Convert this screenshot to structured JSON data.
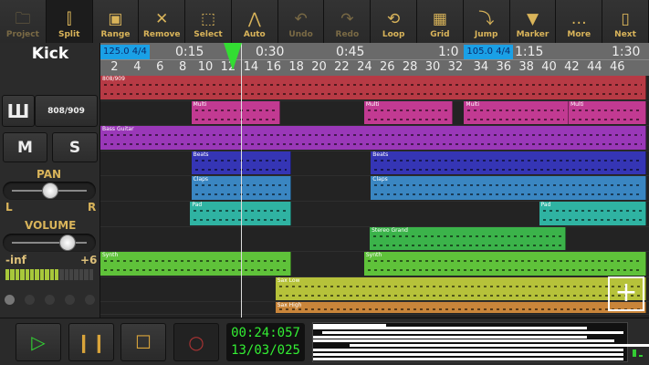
{
  "toolbar": [
    {
      "label": "Project",
      "icon": "folder-icon",
      "glyph": "🗀",
      "dim": true
    },
    {
      "label": "Split",
      "icon": "split-icon",
      "glyph": "⫿",
      "pressed": true
    },
    {
      "label": "Range",
      "icon": "range-icon",
      "glyph": "▣"
    },
    {
      "label": "Remove",
      "icon": "remove-icon",
      "glyph": "✕"
    },
    {
      "label": "Select",
      "icon": "select-icon",
      "glyph": "⬚"
    },
    {
      "label": "Auto",
      "icon": "automation-icon",
      "glyph": "⋀"
    },
    {
      "label": "Undo",
      "icon": "undo-icon",
      "glyph": "↶",
      "dim": true
    },
    {
      "label": "Redo",
      "icon": "redo-icon",
      "glyph": "↷",
      "dim": true
    },
    {
      "label": "Loop",
      "icon": "loop-icon",
      "glyph": "⟲"
    },
    {
      "label": "Grid",
      "icon": "grid-icon",
      "glyph": "▦"
    },
    {
      "label": "Jump",
      "icon": "jump-icon",
      "glyph": "⤵"
    },
    {
      "label": "Marker",
      "icon": "marker-icon",
      "glyph": "▼"
    },
    {
      "label": "More",
      "icon": "more-icon",
      "glyph": "…"
    },
    {
      "label": "Next",
      "icon": "next-icon",
      "glyph": "▯"
    }
  ],
  "track_panel": {
    "track_name": "Kick",
    "instrument": "808/909",
    "instrument_icon": "piano-keys-icon",
    "mute": "M",
    "solo": "S",
    "pan_label": "PAN",
    "pan_left": "L",
    "pan_right": "R",
    "pan_value": 0.5,
    "volume_label": "VOLUME",
    "volume_value": 0.8,
    "meter_min": "-inf",
    "meter_max": "+6",
    "meter_level": 0.6
  },
  "ruler": {
    "tempos": [
      {
        "text": "125.0  4/4",
        "bar": 1
      },
      {
        "text": "105.0  4/4",
        "bar": 33
      }
    ],
    "times": [
      "0:15",
      "0:30",
      "0:45",
      "1:0",
      "1:15",
      "1:30"
    ],
    "bars": [
      "2",
      "4",
      "6",
      "8",
      "10",
      "12",
      "14",
      "16",
      "18",
      "20",
      "22",
      "24",
      "26",
      "28",
      "30",
      "32",
      "34",
      "36",
      "38",
      "40",
      "42",
      "44",
      "46"
    ]
  },
  "tracks": [
    {
      "color": "#b73a45",
      "clips": [
        {
          "name": "808/909",
          "start": 1,
          "end": 49
        }
      ]
    },
    {
      "color": "#c23a92",
      "clips": [
        {
          "name": "Multi",
          "start": 9,
          "end": 16.8
        },
        {
          "name": "Multi",
          "start": 24.2,
          "end": 32
        },
        {
          "name": "Multi",
          "start": 33,
          "end": 42.2
        },
        {
          "name": "Multi",
          "start": 42.2,
          "end": 49
        }
      ]
    },
    {
      "color": "#9a38b8",
      "clips": [
        {
          "name": "Bass Guitar",
          "start": 1,
          "end": 49
        }
      ]
    },
    {
      "color": "#3535b5",
      "clips": [
        {
          "name": "Beats",
          "start": 9,
          "end": 17.8
        },
        {
          "name": "Beats",
          "start": 24.8,
          "end": 49
        }
      ]
    },
    {
      "color": "#3a86c2",
      "clips": [
        {
          "name": "Claps",
          "start": 9,
          "end": 17.8
        },
        {
          "name": "Claps",
          "start": 24.8,
          "end": 49
        }
      ]
    },
    {
      "color": "#2fb3a2",
      "clips": [
        {
          "name": "Pad",
          "start": 8.9,
          "end": 17.8
        },
        {
          "name": "Pad",
          "start": 39.6,
          "end": 49
        }
      ]
    },
    {
      "color": "#3bb34a",
      "clips": [
        {
          "name": "Stereo Grand",
          "start": 24.7,
          "end": 42
        }
      ]
    },
    {
      "color": "#5fc23a",
      "clips": [
        {
          "name": "Synth",
          "start": 1,
          "end": 17.8
        },
        {
          "name": "Synth",
          "start": 24.2,
          "end": 49
        }
      ]
    },
    {
      "color": "#b6c23a",
      "clips": [
        {
          "name": "Sax Low",
          "start": 16.4,
          "end": 49
        }
      ]
    },
    {
      "color": "#c9853a",
      "clips": [
        {
          "name": "Sax High",
          "start": 16.4,
          "end": 49
        }
      ]
    }
  ],
  "transport": {
    "time": "00:24:057",
    "position": "13/03/025"
  }
}
